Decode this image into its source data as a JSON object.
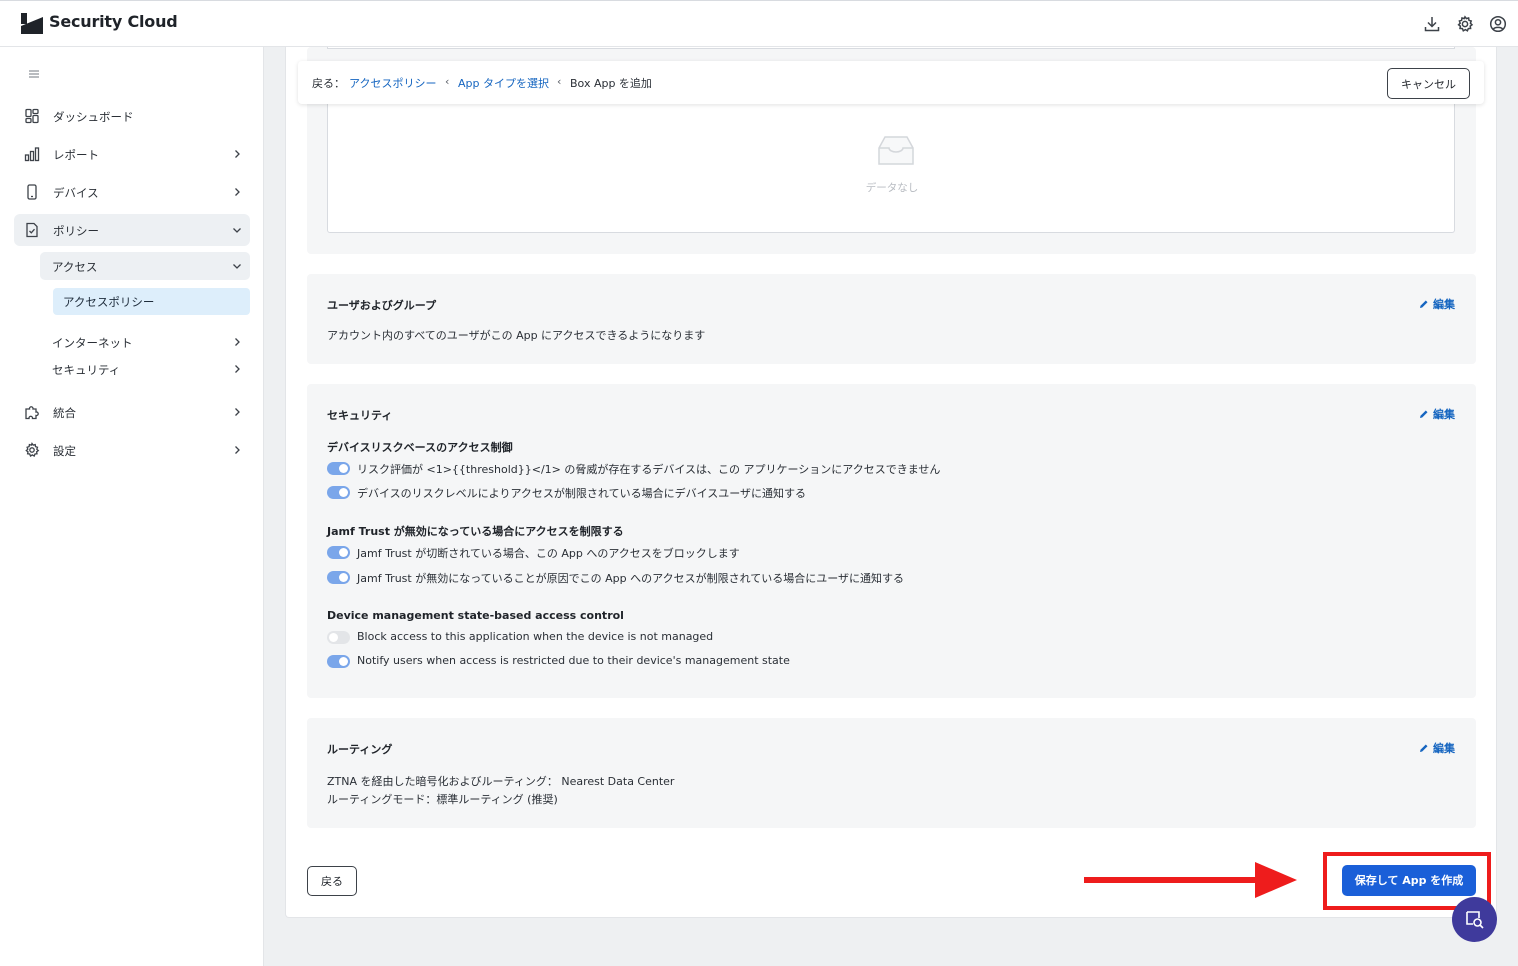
{
  "header": {
    "brand": "Security Cloud",
    "icons": [
      "download-icon",
      "gear-icon",
      "user-circle-icon"
    ]
  },
  "sidebar": {
    "items": [
      {
        "label": "ダッシュボード",
        "icon": "dashboard-icon"
      },
      {
        "label": "レポート",
        "icon": "bar-chart-icon"
      },
      {
        "label": "デバイス",
        "icon": "phone-icon"
      },
      {
        "label": "ポリシー",
        "icon": "policy-document-icon"
      },
      {
        "label": "統合",
        "icon": "puzzle-icon"
      },
      {
        "label": "設定",
        "icon": "gear-icon"
      }
    ],
    "sub": {
      "access": "アクセス",
      "access_policy": "アクセスポリシー",
      "internet": "インターネット",
      "security": "セキュリティ"
    }
  },
  "breadcrumb": {
    "back_label": "戻る：",
    "crumb1": "アクセスポリシー",
    "crumb2": "App タイプを選択",
    "current": "Box App を追加",
    "sep": "‹",
    "cancel": "キャンセル"
  },
  "empty": {
    "text": "データなし"
  },
  "users_section": {
    "title": "ユーザおよびグループ",
    "edit": "編集",
    "text": "アカウント内のすべてのユーザがこの App にアクセスできるようになります"
  },
  "security_section": {
    "title": "セキュリティ",
    "edit": "編集",
    "group1_title": "デバイスリスクベースのアクセス制御",
    "group1_toggles": [
      {
        "label": "リスク評価が <1>{{threshold}}</1> の脅威が存在するデバイスは、この アプリケーションにアクセスできません",
        "on": true
      },
      {
        "label": "デバイスのリスクレベルによりアクセスが制限されている場合にデバイスユーザに通知する",
        "on": true
      }
    ],
    "group2_title": "Jamf Trust が無効になっている場合にアクセスを制限する",
    "group2_toggles": [
      {
        "label": "Jamf Trust が切断されている場合、この App へのアクセスをブロックします",
        "on": true
      },
      {
        "label": "Jamf Trust が無効になっていることが原因でこの App へのアクセスが制限されている場合にユーザに通知する",
        "on": true
      }
    ],
    "group3_title": "Device management state-based access control",
    "group3_toggles": [
      {
        "label": "Block access to this application when the device is not managed",
        "on": false
      },
      {
        "label": "Notify users when access is restricted due to their device's management state",
        "on": true
      }
    ]
  },
  "routing_section": {
    "title": "ルーティング",
    "edit": "編集",
    "line1": "ZTNA を経由した暗号化およびルーティング： Nearest Data Center",
    "line2": "ルーティングモード：標準ルーティング (推奨)"
  },
  "footer": {
    "back": "戻る",
    "save": "保存して App を作成"
  },
  "colors": {
    "accent": "#1a5fd8",
    "link": "#1565c0",
    "toggle_on": "#7aa6ea",
    "annotation": "#ee1c1c",
    "chat": "#3f3a9c"
  }
}
